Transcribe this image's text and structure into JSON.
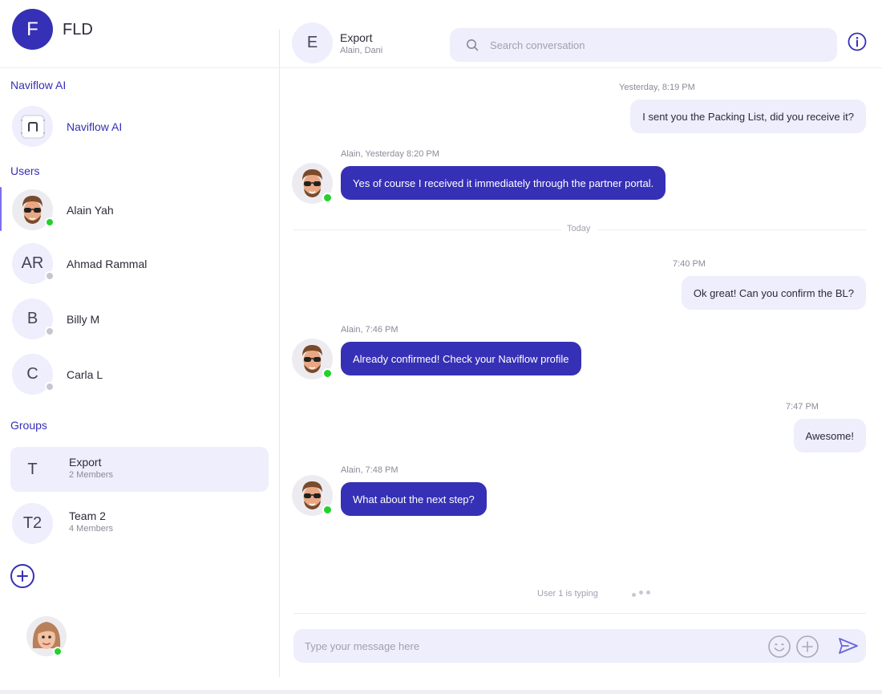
{
  "org": {
    "initial": "F",
    "name": "FLD"
  },
  "sidebar": {
    "ai_section": "Naviflow AI",
    "ai_item": {
      "name": "Naviflow AI",
      "icon": "naviflow-logo-icon"
    },
    "users_section": "Users",
    "users": [
      {
        "name": "Alain Yah",
        "initials": "",
        "avatar": "memoji-man-sunglasses",
        "status": "online"
      },
      {
        "name": "Ahmad Rammal",
        "initials": "AR",
        "status": "offline"
      },
      {
        "name": "Billy M",
        "initials": "B",
        "status": "offline"
      },
      {
        "name": "Carla L",
        "initials": "C",
        "status": "offline"
      }
    ],
    "groups_section": "Groups",
    "groups": [
      {
        "initials": "T",
        "name": "Export",
        "members": "2 Members",
        "active": true
      },
      {
        "initials": "T2",
        "name": "Team 2",
        "members": "4 Members",
        "active": false
      }
    ],
    "add_group_icon": "plus-circle-icon",
    "current_user": {
      "avatar": "memoji-woman",
      "status": "online"
    }
  },
  "header": {
    "initial": "E",
    "title": "Export",
    "members": "Alain, Dani",
    "search_placeholder": "Search conversation",
    "info_icon": "info-icon"
  },
  "messages": [
    {
      "direction": "out",
      "time": "Yesterday, 8:19 PM",
      "text": "I sent you the Packing List, did you receive it?"
    },
    {
      "direction": "in",
      "time": "Alain, Yesterday 8:20 PM",
      "text": "Yes of course I received it immediately through the partner portal."
    },
    {
      "direction": "out",
      "time": "7:40 PM",
      "text": "Ok great! Can you confirm the BL?"
    },
    {
      "direction": "in",
      "time": "Alain, 7:46 PM",
      "text": "Already confirmed! Check your Naviflow profile"
    },
    {
      "direction": "out",
      "time": "7:47 PM",
      "text": "Awesome!"
    },
    {
      "direction": "in",
      "time": "Alain, 7:48 PM",
      "text": "What about the next step?"
    }
  ],
  "day_separator": "Today",
  "typing": "User 1  is typing",
  "composer": {
    "placeholder": "Type your message here",
    "emoji_icon": "smiley-icon",
    "attach_icon": "plus-circle-icon",
    "send_icon": "send-icon"
  },
  "colors": {
    "brand": "#3530b5",
    "bubble_out": "#eeeefc",
    "online": "#22d12c",
    "offline": "#c6c6ce"
  }
}
